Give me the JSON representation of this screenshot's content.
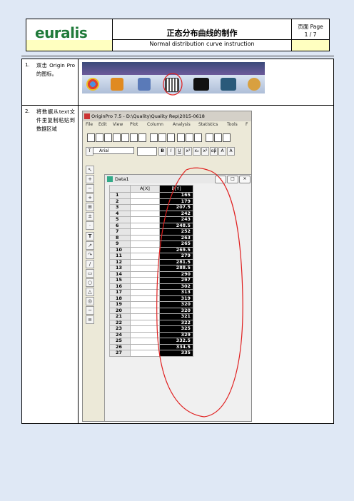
{
  "header": {
    "logo_text": "euralis",
    "logo_tagline": "GRAINES SEMENCES SEEDS",
    "title_cn": "正态分布曲线的制作",
    "title_en": "Normal distribution curve instruction",
    "page_label": "页面 Page",
    "page_number": "1 / 7",
    "highlight_color": "#ffffc0"
  },
  "steps": [
    {
      "number": "1.",
      "text": "双击 Origin Pro 的图标。"
    },
    {
      "number": "2.",
      "text": "将数据从text文件里复制粘贴到数据区域"
    }
  ],
  "origin_window": {
    "title": "OriginPro 7.5 - D:\\Quality\\Quality Rep\\2015-0618",
    "menu": [
      "File",
      "Edit",
      "View",
      "Plot",
      "Column",
      "Analysis",
      "Statistics",
      "Tools",
      "F"
    ],
    "font_name": "Arial",
    "sheet_title": "Data1",
    "columns": [
      "A[X]",
      "B[Y]"
    ],
    "rows": [
      {
        "n": "1",
        "b": "165"
      },
      {
        "n": "2",
        "b": "179"
      },
      {
        "n": "3",
        "b": "207.5"
      },
      {
        "n": "4",
        "b": "242"
      },
      {
        "n": "5",
        "b": "243"
      },
      {
        "n": "6",
        "b": "248.5"
      },
      {
        "n": "7",
        "b": "252"
      },
      {
        "n": "8",
        "b": "263"
      },
      {
        "n": "9",
        "b": "265"
      },
      {
        "n": "10",
        "b": "269.5"
      },
      {
        "n": "11",
        "b": "279"
      },
      {
        "n": "12",
        "b": "281.5"
      },
      {
        "n": "13",
        "b": "288.5"
      },
      {
        "n": "14",
        "b": "290"
      },
      {
        "n": "15",
        "b": "297"
      },
      {
        "n": "16",
        "b": "302"
      },
      {
        "n": "17",
        "b": "313"
      },
      {
        "n": "18",
        "b": "319"
      },
      {
        "n": "19",
        "b": "320"
      },
      {
        "n": "20",
        "b": "320"
      },
      {
        "n": "21",
        "b": "321"
      },
      {
        "n": "22",
        "b": "322"
      },
      {
        "n": "23",
        "b": "325"
      },
      {
        "n": "24",
        "b": "329"
      },
      {
        "n": "25",
        "b": "332.5"
      },
      {
        "n": "26",
        "b": "334.5"
      },
      {
        "n": "27",
        "b": "335"
      }
    ]
  },
  "colors": {
    "annotation": "#e02020",
    "background": "#dfe8f5"
  }
}
